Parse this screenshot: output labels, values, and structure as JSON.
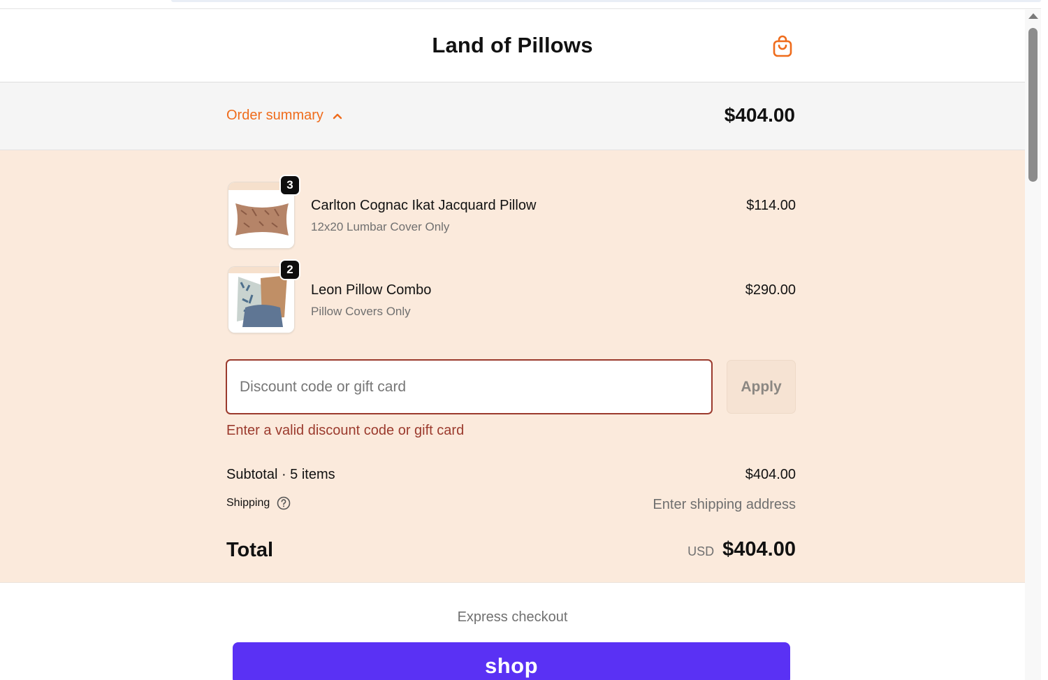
{
  "store": {
    "title": "Land of Pillows"
  },
  "summary": {
    "toggle_label": "Order summary",
    "total": "$404.00"
  },
  "items": [
    {
      "name": "Carlton Cognac Ikat Jacquard Pillow",
      "variant": "12x20 Lumbar Cover Only",
      "price": "$114.00",
      "qty": "3"
    },
    {
      "name": "Leon Pillow Combo",
      "variant": "Pillow Covers Only",
      "price": "$290.00",
      "qty": "2"
    }
  ],
  "discount": {
    "placeholder": "Discount code or gift card",
    "value": "",
    "apply_label": "Apply",
    "error": "Enter a valid discount code or gift card"
  },
  "totals": {
    "subtotal_label": "Subtotal · 5 items",
    "subtotal_value": "$404.00",
    "shipping_label": "Shipping",
    "shipping_value": "Enter shipping address",
    "total_label": "Total",
    "currency": "USD",
    "total_value": "$404.00"
  },
  "express": {
    "label": "Express checkout",
    "shop_pay_label": "shop"
  },
  "colors": {
    "accent": "#ef6c1c",
    "error": "#9b3a2d",
    "panel_bg": "#fbeadc",
    "shop_pay": "#5a31f4"
  },
  "icons": {
    "cart": "shopping-bag-icon",
    "toggle": "chevron-up-icon",
    "help": "question-circle-icon"
  }
}
